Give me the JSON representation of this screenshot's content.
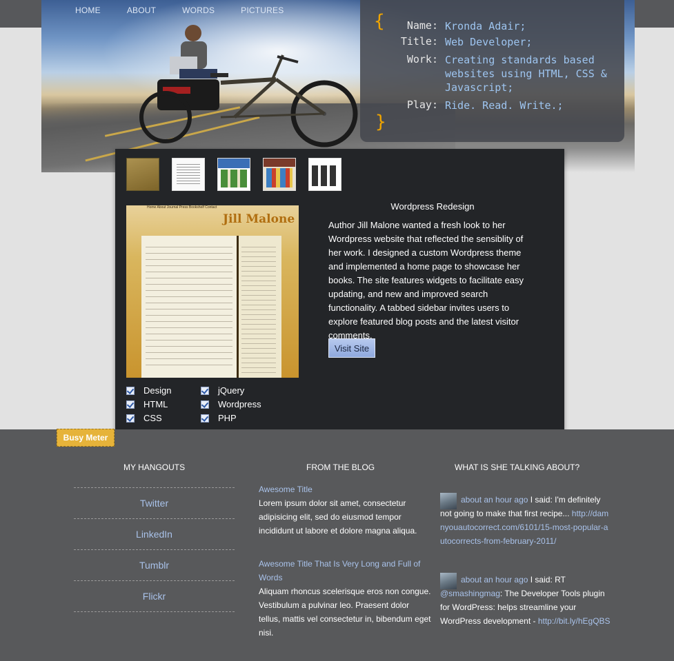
{
  "nav": [
    {
      "label": "HOME"
    },
    {
      "label": "ABOUT"
    },
    {
      "label": "WORDS"
    },
    {
      "label": "PICTURES"
    }
  ],
  "info": {
    "open_brace": "{",
    "close_brace": "}",
    "rows": [
      {
        "key": "Name:",
        "value": "Kronda Adair;"
      },
      {
        "key": "Title:",
        "value": "Web Developer;"
      },
      {
        "key": "Work:",
        "value": "Creating standards based websites using HTML, CSS & Javascript;"
      },
      {
        "key": "Play:",
        "value": "Ride. Read. Write.;"
      }
    ]
  },
  "project": {
    "title": "Wordpress Redesign",
    "description": "Author Jill Malone wanted a fresh look to her Wordpress website that reflected the sensiblity of her work. I designed a custom Wordpress theme and implemented a home page to showcase her books. The site features widgets to facilitate easy updating, and new and improved search functionality. A tabbed sidebar invites users to explore featured blog posts and the latest visitor comments.",
    "visit_label": "Visit Site",
    "screenshot_site_name": "Jill Malone",
    "screenshot_nav": "Home  About  Journal  Press  Bookshelf  Contact",
    "skills": [
      "Design",
      "HTML",
      "CSS",
      "jQuery",
      "Wordpress",
      "PHP"
    ]
  },
  "busy_meter": "Busy Meter",
  "hangouts": {
    "heading": "MY HANGOUTS",
    "items": [
      "Twitter",
      "LinkedIn",
      "Tumblr",
      "Flickr"
    ]
  },
  "blog": {
    "heading": "FROM THE BLOG",
    "posts": [
      {
        "title": "Awesome Title",
        "excerpt": "Lorem ipsum dolor sit amet, consectetur adipisicing elit, sed do eiusmod tempor incididunt ut labore et dolore magna aliqua."
      },
      {
        "title": "Awesome Title That Is Very Long and Full of Words",
        "excerpt": "Aliquam rhoncus scelerisque eros non congue. Vestibulum a pulvinar leo. Praesent dolor tellus, mattis vel consectetur in, bibendum eget nisi."
      }
    ]
  },
  "talk": {
    "heading": "WHAT IS SHE TALKING ABOUT?",
    "tweets": [
      {
        "time": "about an hour ago",
        "text": " I said: I'm definitely not going to make that first recipe...",
        "link": "http://damnyouautocorrect.com/6101/15-most-popular-autocorrects-from-february-2011/"
      },
      {
        "time": "about an hour ago",
        "text": " I said: RT ",
        "mention": "@smashingmag",
        "text2": ": The Developer Tools plugin for WordPress: helps streamline your WordPress development - ",
        "link": "http://bit.ly/hEgQBS"
      }
    ]
  },
  "colors": {
    "accent_orange": "#f0a500",
    "link_blue": "#a9c2ea",
    "panel_dark": "#232528",
    "footer_grey": "#58595b"
  }
}
